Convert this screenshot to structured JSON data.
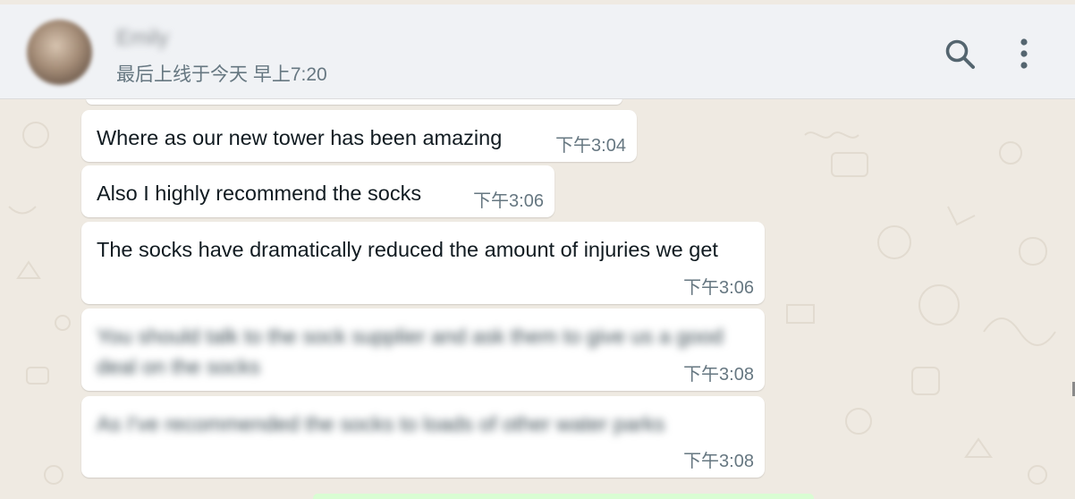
{
  "header": {
    "contact_name": "Emily",
    "last_seen": "最后上线于今天 早上7:20",
    "search_icon": "search-icon",
    "menu_icon": "more-vertical-icon"
  },
  "theme": {
    "chat_background": "#efeae2",
    "header_background": "#f0f2f5",
    "bubble_incoming": "#ffffff",
    "bubble_outgoing": "#d9fdd3"
  },
  "messages": [
    {
      "text": "Where as our new tower has been amazing",
      "time": "下午3:04",
      "blurred": false
    },
    {
      "text": "Also I highly recommend the socks",
      "time": "下午3:06",
      "blurred": false
    },
    {
      "text": "The socks have dramatically reduced the amount of injuries we get",
      "time": "下午3:06",
      "blurred": false
    },
    {
      "text": "You should talk to the sock supplier and ask them to give us a good deal on the socks",
      "time": "下午3:08",
      "blurred": true
    },
    {
      "text": "As I've recommended the socks to loads of other water parks",
      "time": "下午3:08",
      "blurred": true
    }
  ]
}
